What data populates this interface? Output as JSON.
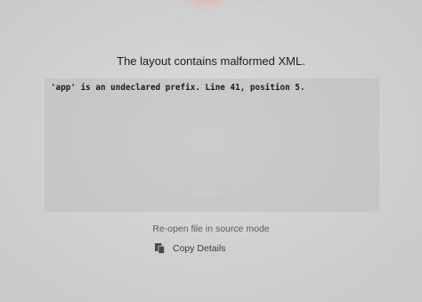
{
  "error": {
    "title": "The layout contains malformed XML.",
    "message": "'app' is an undeclared prefix. Line 41, position 5."
  },
  "actions": {
    "reopen_label": "Re-open file in source mode",
    "copy_label": "Copy Details",
    "copy_icon": "copy-icon"
  }
}
